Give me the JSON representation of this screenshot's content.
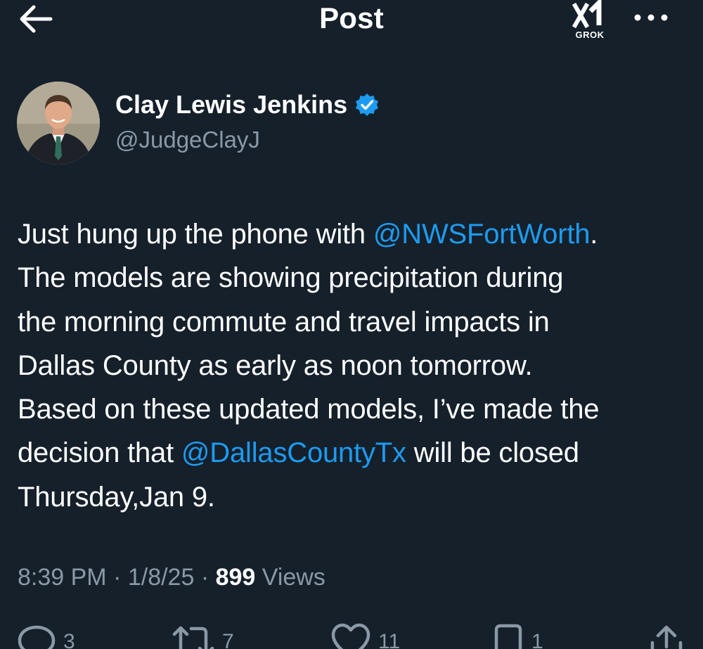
{
  "header": {
    "title": "Post",
    "grok_label": "GROK"
  },
  "author": {
    "name": "Clay Lewis Jenkins",
    "handle": "@JudgeClayJ"
  },
  "tweet": {
    "lines": [
      [
        "Just hung up the phone with ",
        "@NWSFortWorth",
        "."
      ],
      [
        "The models are showing precipitation during"
      ],
      [
        "the morning commute and travel impacts in"
      ],
      [
        "Dallas County as early as noon tomorrow."
      ],
      [
        "Based on these updated models, I’ve made the"
      ],
      [
        "decision that ",
        "@DallasCountyTx",
        " will be closed"
      ],
      [
        "Thursday,Jan 9."
      ]
    ]
  },
  "meta": {
    "time": "8:39 PM",
    "separator": " · ",
    "date": "1/8/25",
    "views_count": "899",
    "views_label": " Views"
  },
  "actions": {
    "replies": "3",
    "reposts": "7",
    "likes": "11",
    "bookmarks": "1"
  },
  "colors": {
    "background": "#15202b",
    "text": "#ffffff",
    "secondary": "#8b98a5",
    "link": "#1d9bf0"
  }
}
